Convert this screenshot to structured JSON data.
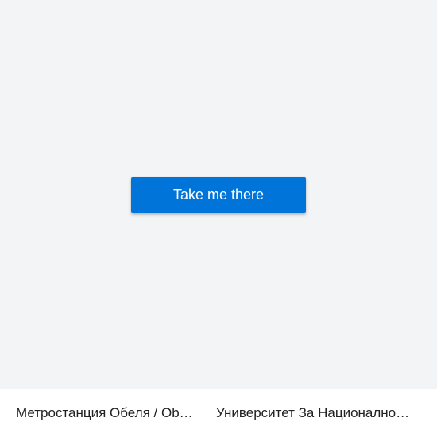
{
  "main": {
    "cta_label": "Take me there"
  },
  "footer": {
    "origin_stop": "Метростанция Обеля / Obelya Metro Station",
    "destination_stop": "Университет За Национално И Световно Стопанство"
  },
  "colors": {
    "background": "#f3f4f6",
    "button": "#0074d9",
    "button_text": "#ffffff",
    "footer_background": "#ffffff",
    "footer_text": "#222222"
  }
}
